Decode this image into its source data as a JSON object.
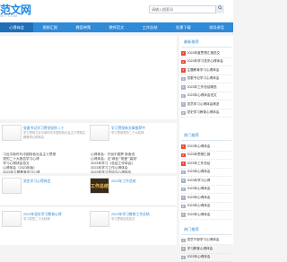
{
  "header": {
    "logo_text": "范文网",
    "logo_sub": "WT. COM",
    "search_placeholder": "请输入搜索词",
    "search_icon": "search-icon"
  },
  "nav": {
    "items": [
      "心得体会",
      "思想汇报",
      "教案带策",
      "教师范文",
      "工作总结",
      "党课下载",
      "领导讲话"
    ]
  },
  "section1": {
    "card_left": {
      "title": "党委书记学习贯彻党的二十",
      "desc": "学习贯彻习近平新时代中国特色社会主义思想主题教育心得体会"
    },
    "card_right": {
      "title": "学习贯彻新文章推荐中",
      "desc": "学习贯彻党的二十大精神"
    },
    "list_left": [
      "习近平新时代中国特色社会主义思想",
      "党的二十大报告学习心得",
      "学习心得体会范文",
      "心得体会（2023年版）",
      "2023年主题教育学习心得"
    ],
    "list_right": [
      "心得体会：开创中国梦 新奋进",
      "心得体会：论\"绿色\"\"常爱\"\"高效\"",
      "2023年学习《总结工作体会》",
      "2023年学习工作心得体会",
      "2023年学习总结与心得体会"
    ]
  },
  "section2": {
    "card_left": {
      "title": "党史学习心得体会",
      "desc": ""
    },
    "card_right": {
      "image_label": "工作总结",
      "title": "2023年工作总结",
      "desc": ""
    },
    "list_left": [
      "习近平新时代中国特色社会主义",
      "党的二十大报告学习心得",
      "2023年主题教育学习心得体会",
      "2023年学习心得体会精选",
      "2023年度工作总结及心得体会汇总"
    ],
    "list_right": [
      "心得体会：开创中国梦 奋进新",
      "心得体会：论\"绿色\"\"常爱\"\"高效\"",
      "2023年学习《总结工作体会》",
      "2023年学习工作心得体会",
      "2023年度总结与心得体会"
    ]
  },
  "section3": {
    "card_left": {
      "title": "2023年党史学习教育心得",
      "desc": "学习党的二十大精神"
    },
    "card_right": {
      "title": "2023年学习教育工作总结",
      "desc": "学习贯彻总结范文"
    }
  },
  "sidebar": {
    "section1_title": "最新推荐",
    "section1_items": [
      "2023年度思想汇报范文",
      "2023年学习党史心得体会",
      "主题教育学习心得体会",
      "党委书记学习心得体会",
      "2023年工作总结精选",
      "2023年心得体会范文",
      "党员学习心得体会精选",
      "党史学习教育心得体会"
    ],
    "section2_title": "热门推荐",
    "section2_items": [
      "2023年心得体会",
      "2023年思想汇报",
      "2023年工作总结",
      "2023年心得体会",
      "2023年学习心得",
      "2023年心得体会",
      "2023年心得体会",
      "2023年心得体会",
      "2023年心得体会"
    ],
    "section3_title": "热门推荐",
    "section3_items": [
      "党员干部学习心得体会",
      "学习教育心得体会",
      "2023年心得体会"
    ]
  }
}
